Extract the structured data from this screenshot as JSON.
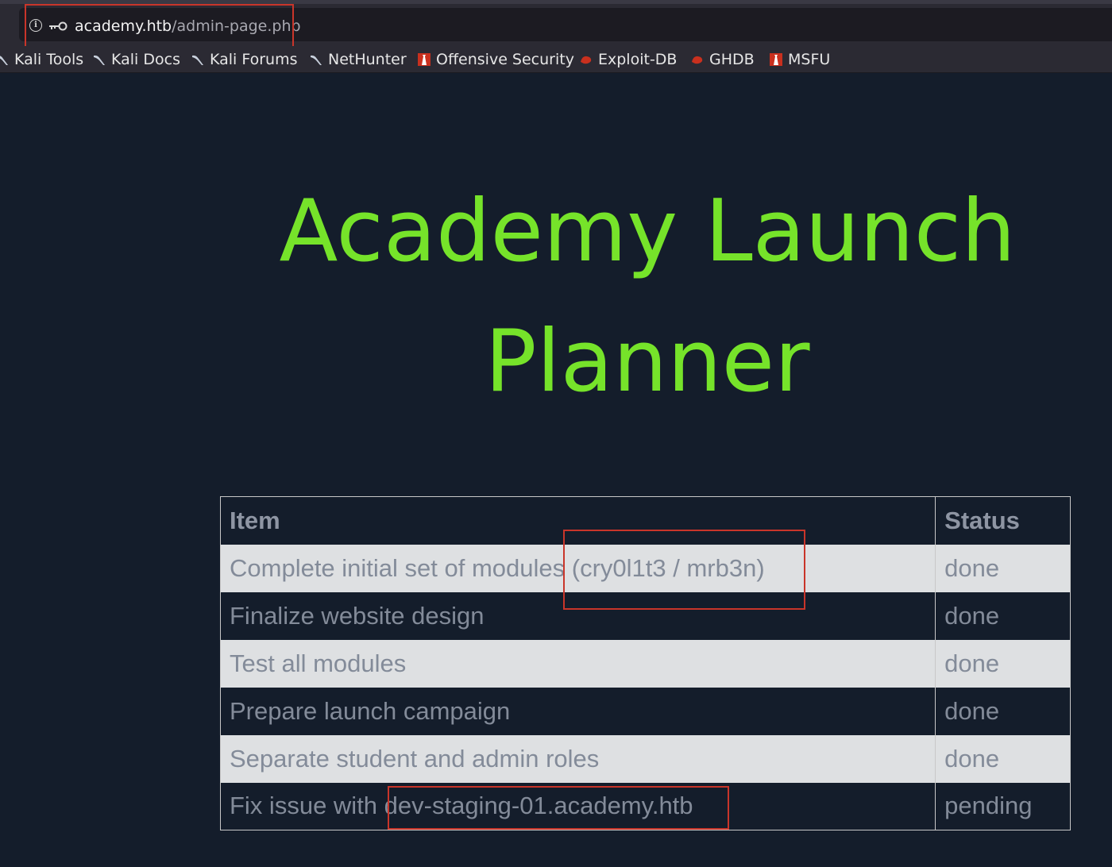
{
  "browser": {
    "url_host": "academy.htb",
    "url_path": "/admin-page.php",
    "icons": [
      "info-icon",
      "key-icon"
    ],
    "bookmarks": [
      {
        "label": "Kali Tools",
        "icon": "kali-dragon-icon"
      },
      {
        "label": "Kali Docs",
        "icon": "kali-dragon-icon"
      },
      {
        "label": "Kali Forums",
        "icon": "kali-dragon-icon"
      },
      {
        "label": "NetHunter",
        "icon": "kali-dragon-icon"
      },
      {
        "label": "Offensive Security",
        "icon": "offsec-icon"
      },
      {
        "label": "Exploit-DB",
        "icon": "exploitdb-icon"
      },
      {
        "label": "GHDB",
        "icon": "exploitdb-icon"
      },
      {
        "label": "MSFU",
        "icon": "offsec-icon"
      }
    ]
  },
  "page": {
    "title_line1": "Academy Launch",
    "title_line2": "Planner",
    "title_color": "#76e32a",
    "background": "#141d2b",
    "table": {
      "headers": [
        "Item",
        "Status"
      ],
      "rows": [
        {
          "item": "Complete initial set of modules (cry0l1t3 / mrb3n)",
          "status": "done"
        },
        {
          "item": "Finalize website design",
          "status": "done"
        },
        {
          "item": "Test all modules",
          "status": "done"
        },
        {
          "item": "Prepare launch campaign",
          "status": "done"
        },
        {
          "item": "Separate student and admin roles",
          "status": "done"
        },
        {
          "item": "Fix issue with dev-staging-01.academy.htb",
          "status": "pending"
        }
      ]
    },
    "highlight_color": "#c9352a"
  }
}
